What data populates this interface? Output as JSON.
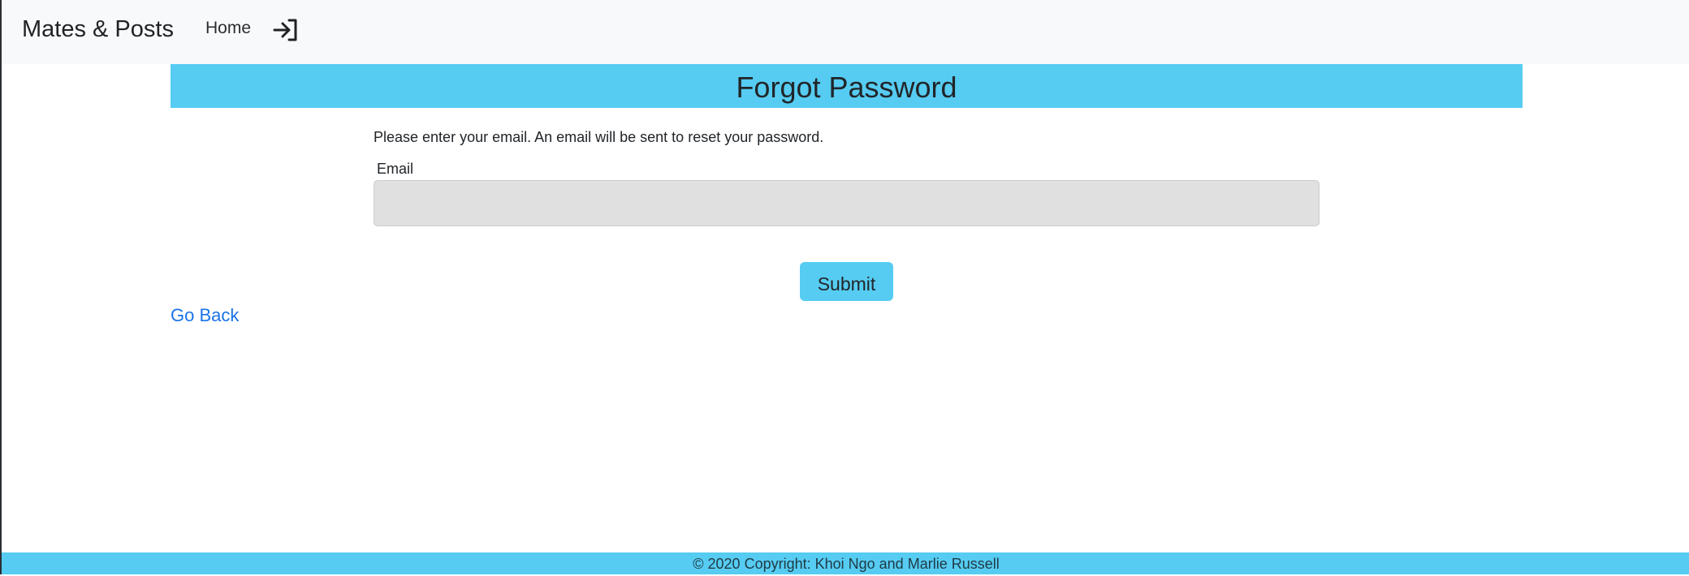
{
  "navbar": {
    "brand": "Mates & Posts",
    "home_label": "Home",
    "login_icon": "login-icon"
  },
  "main": {
    "title": "Forgot Password",
    "instructions": "Please enter your email. An email will be sent to reset your password.",
    "email_label": "Email",
    "email_value": "",
    "email_placeholder": "",
    "submit_label": "Submit",
    "go_back_label": "Go Back"
  },
  "footer": {
    "copyright": "© 2020 Copyright: Khoi Ngo and Marlie Russell"
  },
  "colors": {
    "accent": "#56ccf2",
    "navbar_bg": "#f8f9fa",
    "link": "#1a73e8",
    "input_bg": "#e0e0e0"
  }
}
